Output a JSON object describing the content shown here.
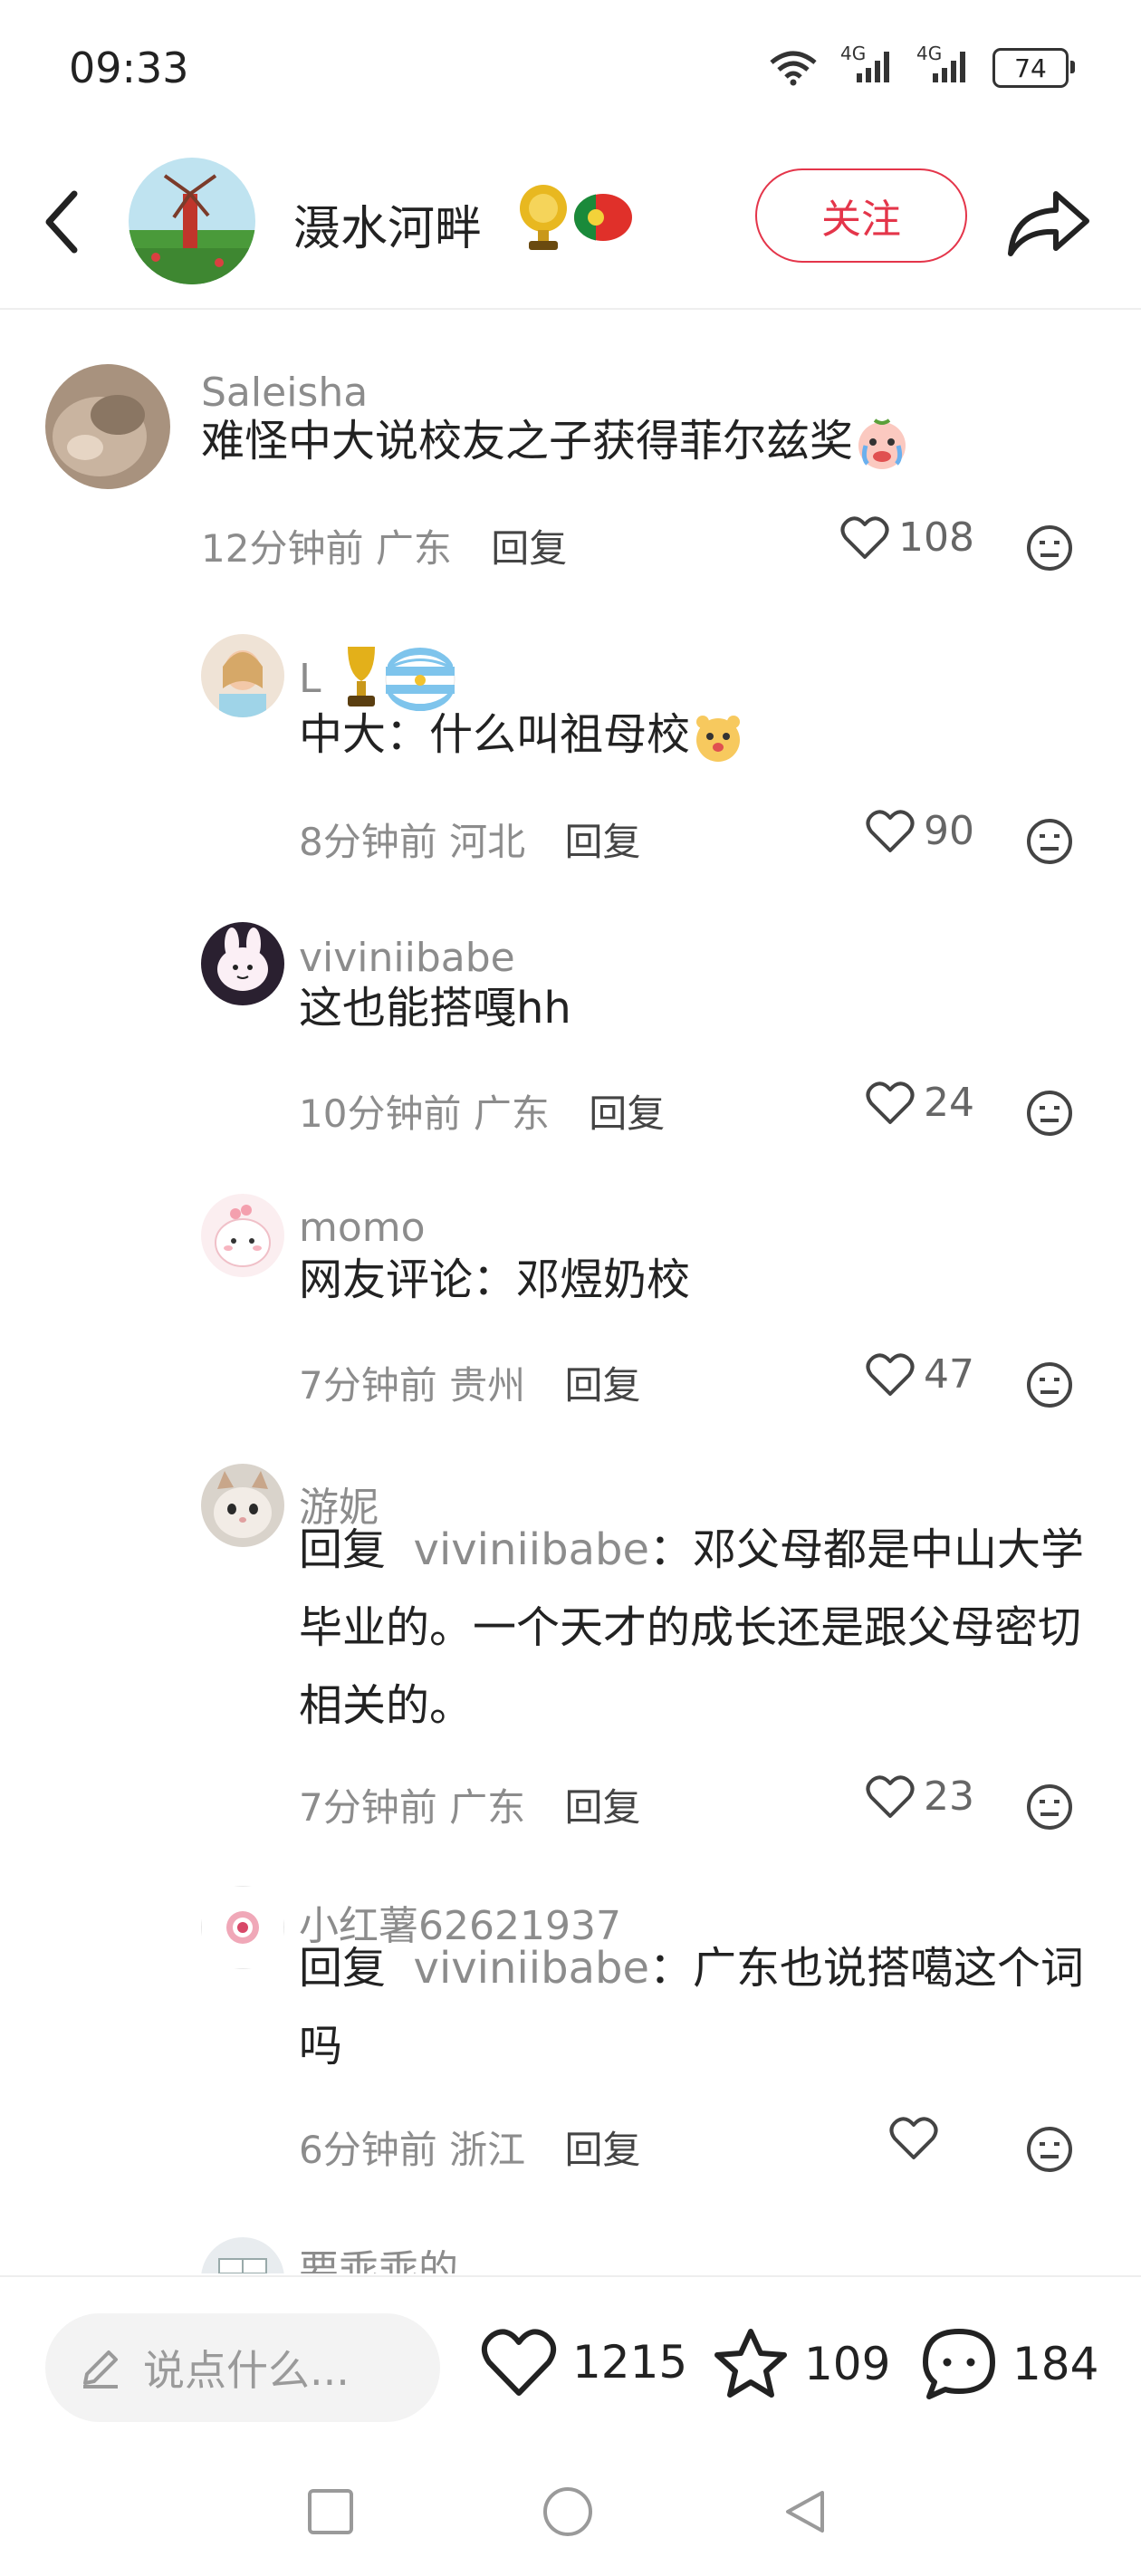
{
  "status_bar": {
    "time": "09:33",
    "signal_1": "4G",
    "signal_2": "4G",
    "battery": "74"
  },
  "header": {
    "author": "滠水河畔",
    "follow_label": "关注"
  },
  "comments": [
    {
      "user": "Saleisha",
      "text": "难怪中大说校友之子获得菲尔兹奖",
      "time": "12分钟前",
      "location": "广东",
      "reply": "回复",
      "likes": "108"
    },
    {
      "user": "L",
      "text": "中大：什么叫祖母校",
      "time": "8分钟前",
      "location": "河北",
      "reply": "回复",
      "likes": "90"
    },
    {
      "user": "viviniibabe",
      "text": "这也能搭嘎hh",
      "time": "10分钟前",
      "location": "广东",
      "reply": "回复",
      "likes": "24"
    },
    {
      "user": "momo",
      "text": "网友评论：邓煜奶校",
      "time": "7分钟前",
      "location": "贵州",
      "reply": "回复",
      "likes": "47"
    },
    {
      "user": "游妮",
      "reply_prefix": "回复",
      "reply_to": "viviniibabe",
      "text": "：邓父母都是中山大学毕业的。一个天才的成长还是跟父母密切相关的。",
      "time": "7分钟前",
      "location": "广东",
      "reply": "回复",
      "likes": "23"
    },
    {
      "user": "小红薯62621937",
      "reply_prefix": "回复",
      "reply_to": "viviniibabe",
      "text": "：广东也说搭噶这个词吗",
      "time": "6分钟前",
      "location": "浙江",
      "reply": "回复",
      "likes": ""
    },
    {
      "user": "要乖乖的"
    }
  ],
  "bottom_bar": {
    "placeholder": "说点什么...",
    "likes": "1215",
    "collects": "109",
    "comments": "184"
  },
  "colors": {
    "accent": "#e4354a",
    "muted_text": "#8c8c8c"
  }
}
